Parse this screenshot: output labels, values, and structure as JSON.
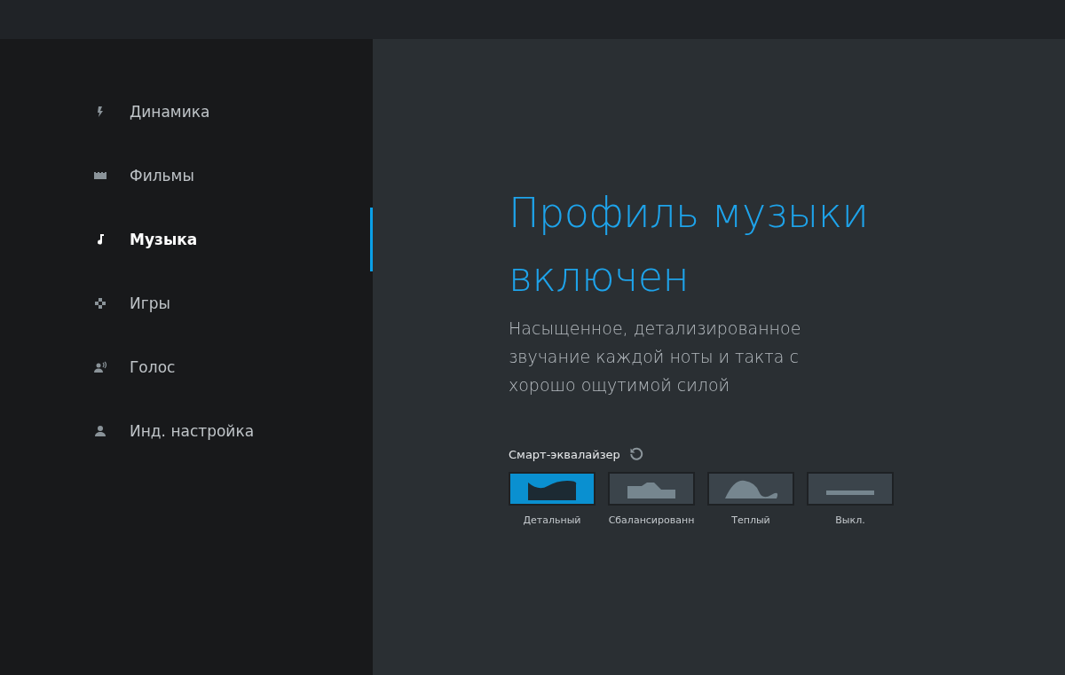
{
  "sidebar": {
    "items": [
      {
        "label": "Динамика",
        "kind": "dynamic",
        "selected": false
      },
      {
        "label": "Фильмы",
        "kind": "movies",
        "selected": false
      },
      {
        "label": "Музыка",
        "kind": "music",
        "selected": true
      },
      {
        "label": "Игры",
        "kind": "games",
        "selected": false
      },
      {
        "label": "Голос",
        "kind": "voice",
        "selected": false
      },
      {
        "label": "Инд. настройка",
        "kind": "custom",
        "selected": false
      }
    ]
  },
  "profile": {
    "title": "Профиль музыки включен",
    "description": "Насыщенное, детализированное звучание каждой ноты и такта с хорошо ощутимой силой"
  },
  "equalizer": {
    "label": "Смарт-эквалайзер",
    "presets": [
      {
        "label": "Детальный",
        "kind": "detailed",
        "selected": true
      },
      {
        "label": "Сбалансированн",
        "kind": "balanced",
        "selected": false
      },
      {
        "label": "Теплый",
        "kind": "warm",
        "selected": false
      },
      {
        "label": "Выкл.",
        "kind": "off",
        "selected": false
      }
    ]
  }
}
